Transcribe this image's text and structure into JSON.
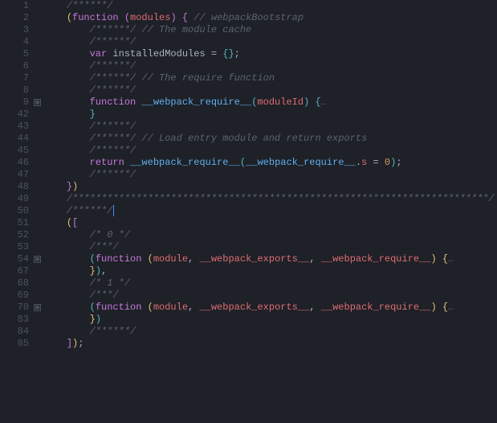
{
  "lines": [
    {
      "num": "1",
      "fold": "",
      "hl": false,
      "tokens": [
        [
          "    ",
          ""
        ],
        [
          "/******/",
          "comment"
        ]
      ]
    },
    {
      "num": "2",
      "fold": "",
      "hl": false,
      "tokens": [
        [
          "    ",
          ""
        ],
        [
          "(",
          "paren-y"
        ],
        [
          "function ",
          "keyword"
        ],
        [
          "(",
          "paren-p"
        ],
        [
          "modules",
          "param"
        ],
        [
          ")",
          "paren-p"
        ],
        [
          " ",
          ""
        ],
        [
          "{",
          "paren-p"
        ],
        [
          " ",
          ""
        ],
        [
          "// webpackBootstrap",
          "comment"
        ]
      ]
    },
    {
      "num": "3",
      "fold": "",
      "hl": false,
      "tokens": [
        [
          "        ",
          ""
        ],
        [
          "/******/",
          "comment"
        ],
        [
          " ",
          ""
        ],
        [
          "// The module cache",
          "comment"
        ]
      ]
    },
    {
      "num": "4",
      "fold": "",
      "hl": false,
      "tokens": [
        [
          "        ",
          ""
        ],
        [
          "/******/",
          "comment"
        ]
      ]
    },
    {
      "num": "5",
      "fold": "",
      "hl": false,
      "tokens": [
        [
          "        ",
          ""
        ],
        [
          "var ",
          "keyword"
        ],
        [
          "installedModules",
          "defvar"
        ],
        [
          " = ",
          ""
        ],
        [
          "{}",
          "paren-b"
        ],
        [
          ";",
          "punct"
        ]
      ]
    },
    {
      "num": "6",
      "fold": "",
      "hl": false,
      "tokens": [
        [
          "        ",
          ""
        ],
        [
          "/******/",
          "comment"
        ]
      ]
    },
    {
      "num": "7",
      "fold": "",
      "hl": false,
      "tokens": [
        [
          "        ",
          ""
        ],
        [
          "/******/",
          "comment"
        ],
        [
          " ",
          ""
        ],
        [
          "// The require function",
          "comment"
        ]
      ]
    },
    {
      "num": "8",
      "fold": "",
      "hl": false,
      "tokens": [
        [
          "        ",
          ""
        ],
        [
          "/******/",
          "comment"
        ]
      ]
    },
    {
      "num": "9",
      "fold": "+",
      "hl": false,
      "tokens": [
        [
          "        ",
          ""
        ],
        [
          "function ",
          "keyword"
        ],
        [
          "__webpack_require__",
          "funcname"
        ],
        [
          "(",
          "paren-b"
        ],
        [
          "moduleId",
          "param"
        ],
        [
          ")",
          "paren-b"
        ],
        [
          " ",
          ""
        ],
        [
          "{",
          "paren-b"
        ],
        [
          "…",
          "comment"
        ]
      ]
    },
    {
      "num": "42",
      "fold": "",
      "hl": false,
      "tokens": [
        [
          "        ",
          ""
        ],
        [
          "}",
          "paren-b"
        ]
      ]
    },
    {
      "num": "43",
      "fold": "",
      "hl": false,
      "tokens": [
        [
          "        ",
          ""
        ],
        [
          "/******/",
          "comment"
        ]
      ]
    },
    {
      "num": "44",
      "fold": "",
      "hl": false,
      "tokens": [
        [
          "        ",
          ""
        ],
        [
          "/******/",
          "comment"
        ],
        [
          " ",
          ""
        ],
        [
          "// Load entry module and return exports",
          "comment"
        ]
      ]
    },
    {
      "num": "45",
      "fold": "",
      "hl": false,
      "tokens": [
        [
          "        ",
          ""
        ],
        [
          "/******/",
          "comment"
        ]
      ]
    },
    {
      "num": "46",
      "fold": "",
      "hl": false,
      "tokens": [
        [
          "        ",
          ""
        ],
        [
          "return ",
          "keyword"
        ],
        [
          "__webpack_require__",
          "funcname"
        ],
        [
          "(",
          "paren-b"
        ],
        [
          "__webpack_require__",
          "funcname"
        ],
        [
          ".",
          ""
        ],
        [
          "s",
          "prop"
        ],
        [
          " = ",
          ""
        ],
        [
          "0",
          "number"
        ],
        [
          ")",
          "paren-b"
        ],
        [
          ";",
          "punct"
        ]
      ]
    },
    {
      "num": "47",
      "fold": "",
      "hl": false,
      "tokens": [
        [
          "        ",
          ""
        ],
        [
          "/******/",
          "comment"
        ]
      ]
    },
    {
      "num": "48",
      "fold": "",
      "hl": false,
      "tokens": [
        [
          "    ",
          ""
        ],
        [
          "}",
          "paren-p"
        ],
        [
          ")",
          "paren-y"
        ]
      ]
    },
    {
      "num": "49",
      "fold": "",
      "hl": false,
      "tokens": [
        [
          "    ",
          ""
        ],
        [
          "/************************************************************************/",
          "comment"
        ]
      ]
    },
    {
      "num": "50",
      "fold": "",
      "hl": true,
      "tokens": [
        [
          "    ",
          ""
        ],
        [
          "/******/",
          "comment"
        ],
        [
          "|",
          "cursor-marker"
        ]
      ]
    },
    {
      "num": "51",
      "fold": "",
      "hl": false,
      "tokens": [
        [
          "    ",
          ""
        ],
        [
          "(",
          "paren-y"
        ],
        [
          "[",
          "paren-p"
        ]
      ]
    },
    {
      "num": "52",
      "fold": "",
      "hl": false,
      "tokens": [
        [
          "        ",
          ""
        ],
        [
          "/* 0 */",
          "comment"
        ]
      ]
    },
    {
      "num": "53",
      "fold": "",
      "hl": false,
      "tokens": [
        [
          "        ",
          ""
        ],
        [
          "/***/",
          "comment"
        ]
      ]
    },
    {
      "num": "54",
      "fold": "+",
      "hl": false,
      "tokens": [
        [
          "        ",
          ""
        ],
        [
          "(",
          "paren-b"
        ],
        [
          "function ",
          "keyword"
        ],
        [
          "(",
          "paren-y"
        ],
        [
          "module",
          "param"
        ],
        [
          ", ",
          ""
        ],
        [
          "__webpack_exports__",
          "param"
        ],
        [
          ", ",
          ""
        ],
        [
          "__webpack_require__",
          "param"
        ],
        [
          ")",
          "paren-y"
        ],
        [
          " ",
          ""
        ],
        [
          "{",
          "paren-y"
        ],
        [
          "…",
          "comment"
        ]
      ]
    },
    {
      "num": "67",
      "fold": "",
      "hl": false,
      "tokens": [
        [
          "        ",
          ""
        ],
        [
          "}",
          "paren-y"
        ],
        [
          ")",
          "paren-b"
        ],
        [
          ",",
          "punct"
        ]
      ]
    },
    {
      "num": "68",
      "fold": "",
      "hl": false,
      "tokens": [
        [
          "        ",
          ""
        ],
        [
          "/* 1 */",
          "comment"
        ]
      ]
    },
    {
      "num": "69",
      "fold": "",
      "hl": false,
      "tokens": [
        [
          "        ",
          ""
        ],
        [
          "/***/",
          "comment"
        ]
      ]
    },
    {
      "num": "70",
      "fold": "+",
      "hl": false,
      "tokens": [
        [
          "        ",
          ""
        ],
        [
          "(",
          "paren-b"
        ],
        [
          "function ",
          "keyword"
        ],
        [
          "(",
          "paren-y"
        ],
        [
          "module",
          "param"
        ],
        [
          ", ",
          ""
        ],
        [
          "__webpack_exports__",
          "param"
        ],
        [
          ", ",
          ""
        ],
        [
          "__webpack_require__",
          "param"
        ],
        [
          ")",
          "paren-y"
        ],
        [
          " ",
          ""
        ],
        [
          "{",
          "paren-y"
        ],
        [
          "…",
          "comment"
        ]
      ]
    },
    {
      "num": "83",
      "fold": "",
      "hl": false,
      "tokens": [
        [
          "        ",
          ""
        ],
        [
          "}",
          "paren-y"
        ],
        [
          ")",
          "paren-b"
        ]
      ]
    },
    {
      "num": "84",
      "fold": "",
      "hl": false,
      "tokens": [
        [
          "        ",
          ""
        ],
        [
          "/******/",
          "comment"
        ]
      ]
    },
    {
      "num": "85",
      "fold": "",
      "hl": false,
      "tokens": [
        [
          "    ",
          ""
        ],
        [
          "]",
          "paren-p"
        ],
        [
          ")",
          "paren-y"
        ],
        [
          ";",
          "punct"
        ]
      ]
    }
  ]
}
